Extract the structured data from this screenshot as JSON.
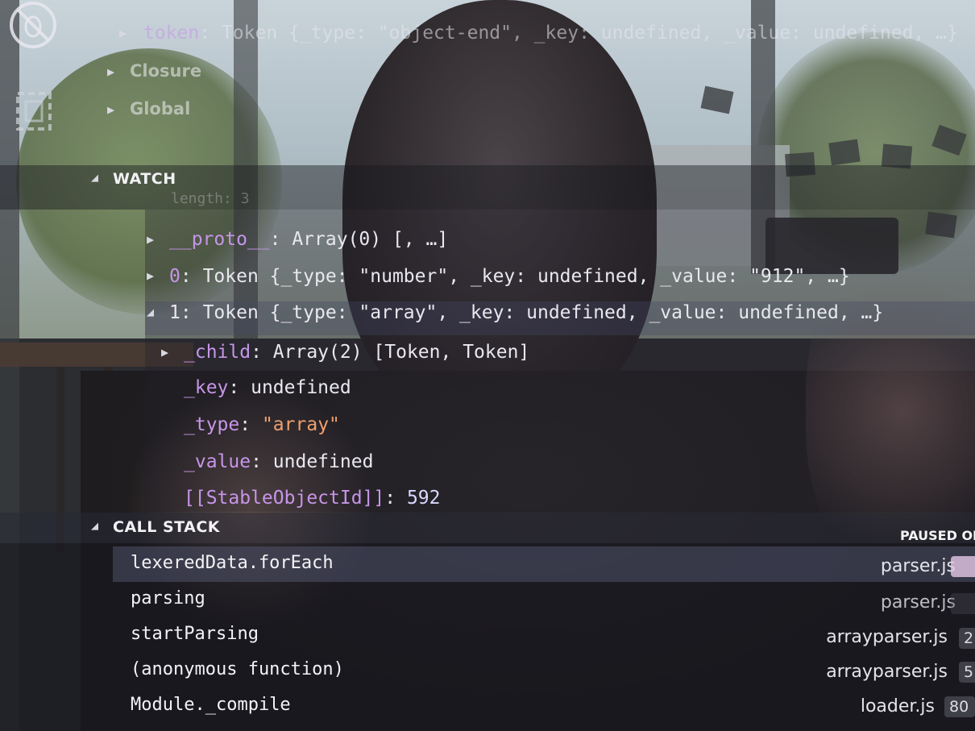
{
  "scope": {
    "token_row": {
      "key": "token",
      "value": "Token {_type: \"object-end\", _key: undefined, _value: undefined, …}"
    },
    "closure_label": "Closure",
    "global_label": "Global"
  },
  "watch": {
    "header": "WATCH",
    "length_row": "length: 3",
    "proto_row": {
      "key": "__proto__",
      "value": "Array(0) [, …]"
    },
    "item0": {
      "index": "0",
      "value": "Token {_type: \"number\", _key: undefined, _value: \"912\", …}"
    },
    "item1": {
      "index": "1",
      "value": "Token {_type: \"array\", _key: undefined, _value: undefined, …}"
    },
    "child": {
      "key": "_child",
      "value": "Array(2) [Token, Token]"
    },
    "key_prop": {
      "key": "_key",
      "value": "undefined"
    },
    "type_prop": {
      "key": "_type",
      "value": "\"array\""
    },
    "value_prop": {
      "key": "_value",
      "value": "undefined"
    },
    "stable_id": {
      "key": "[[StableObjectId]]",
      "value": "592"
    }
  },
  "call_stack": {
    "header": "CALL STACK",
    "status": "PAUSED OI",
    "frames": [
      {
        "fn": "lexeredData.forEach",
        "file": "parser.js",
        "line": ""
      },
      {
        "fn": "parsing",
        "file": "parser.js",
        "line": ""
      },
      {
        "fn": "startParsing",
        "file": "arrayparser.js",
        "line": "2"
      },
      {
        "fn": "(anonymous function)",
        "file": "arrayparser.js",
        "line": "5"
      },
      {
        "fn": "Module._compile",
        "file": "loader.js",
        "line": "80"
      }
    ]
  },
  "colors": {
    "keyword": "#c795e8",
    "string": "#f0a06e",
    "text": "#e8e8ee"
  },
  "icons": [
    "bug-disabled-icon",
    "layout-icon"
  ]
}
